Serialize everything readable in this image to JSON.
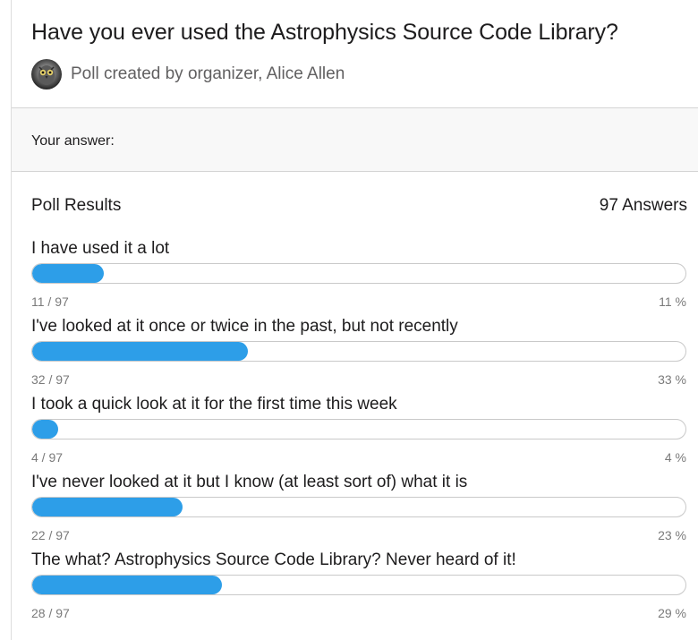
{
  "poll": {
    "question": "Have you ever used the Astrophysics Source Code Library?",
    "creator_text": "Poll created by organizer, Alice Allen",
    "your_answer_label": "Your answer:",
    "results_title": "Poll Results",
    "answers_count": "97 Answers",
    "accent_color": "#2d9ee8",
    "options": [
      {
        "label": "I have used it a lot",
        "count": "11 / 97",
        "percent": "11 %",
        "fraction": 0.11
      },
      {
        "label": "I've looked at it once or twice in the past, but not recently",
        "count": "32 / 97",
        "percent": "33 %",
        "fraction": 0.33
      },
      {
        "label": "I took a quick look at it for the first time this week",
        "count": "4 / 97",
        "percent": "4 %",
        "fraction": 0.04
      },
      {
        "label": "I've never looked at it but I know (at least sort of) what it is",
        "count": "22 / 97",
        "percent": "23 %",
        "fraction": 0.23
      },
      {
        "label": "The what? Astrophysics Source Code Library? Never heard of it!",
        "count": "28 / 97",
        "percent": "29 %",
        "fraction": 0.29
      }
    ]
  }
}
